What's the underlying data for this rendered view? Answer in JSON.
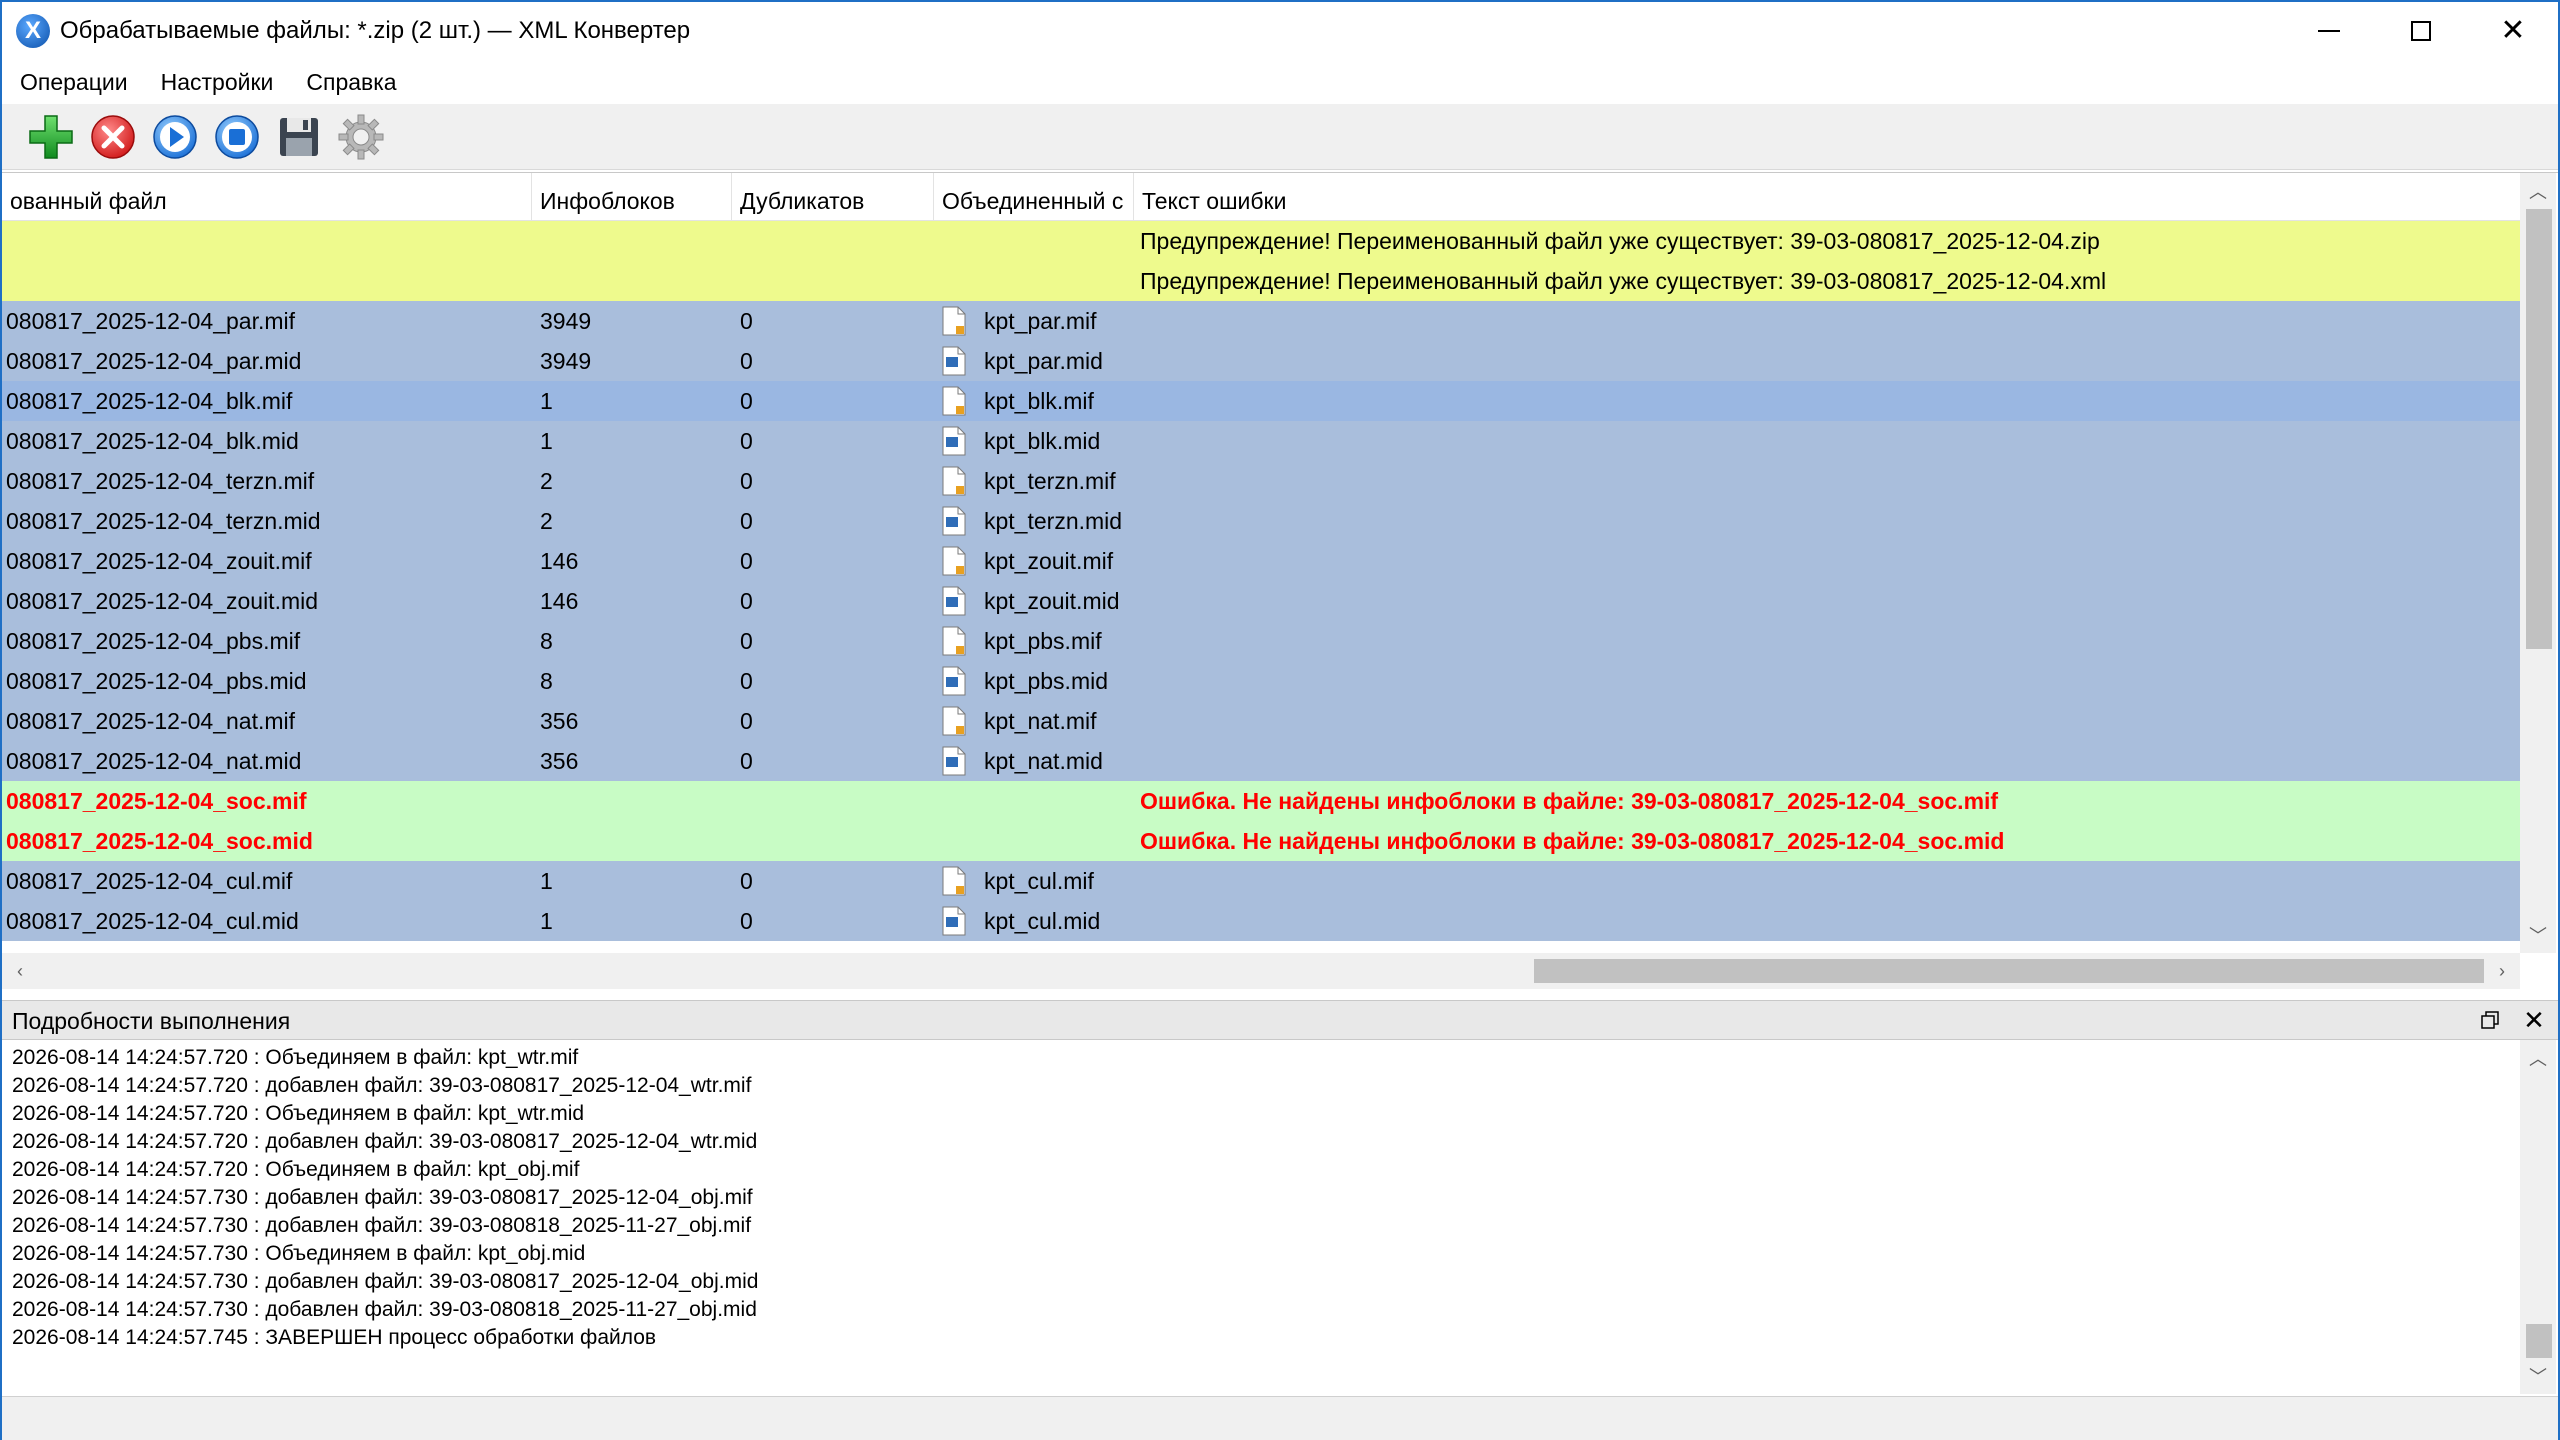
{
  "window": {
    "title": "Обрабатываемые файлы: *.zip (2 шт.) — XML Конвертер",
    "app_icon": "X"
  },
  "menu": [
    "Операции",
    "Настройки",
    "Справка"
  ],
  "toolbar": {
    "icons": [
      "add-icon",
      "cancel-icon",
      "play-icon",
      "stop-icon",
      "save-icon",
      "settings-gear-icon"
    ]
  },
  "grid": {
    "columns": [
      "ованный файл",
      "Инфоблоков",
      "Дубликатов",
      "Объединенный с",
      "Текст ошибки"
    ],
    "rows": [
      {
        "kind": "warn",
        "file": "",
        "info": "",
        "dup": "",
        "merged": "",
        "icon": "",
        "error": "Предупреждение! Переименованный файл уже существует: 39-03-080817_2025-12-04.zip"
      },
      {
        "kind": "warn",
        "file": "",
        "info": "",
        "dup": "",
        "merged": "",
        "icon": "",
        "error": "Предупреждение! Переименованный файл уже существует: 39-03-080817_2025-12-04.xml"
      },
      {
        "kind": "norm",
        "file": "080817_2025-12-04_par.mif",
        "info": "3949",
        "dup": "0",
        "merged": "kpt_par.mif",
        "icon": "mif",
        "error": ""
      },
      {
        "kind": "norm",
        "file": "080817_2025-12-04_par.mid",
        "info": "3949",
        "dup": "0",
        "merged": "kpt_par.mid",
        "icon": "mid",
        "error": ""
      },
      {
        "kind": "sel",
        "file": "080817_2025-12-04_blk.mif",
        "info": "1",
        "dup": "0",
        "merged": "kpt_blk.mif",
        "icon": "mif",
        "error": ""
      },
      {
        "kind": "norm",
        "file": "080817_2025-12-04_blk.mid",
        "info": "1",
        "dup": "0",
        "merged": "kpt_blk.mid",
        "icon": "mid",
        "error": ""
      },
      {
        "kind": "norm",
        "file": "080817_2025-12-04_terzn.mif",
        "info": "2",
        "dup": "0",
        "merged": "kpt_terzn.mif",
        "icon": "mif",
        "error": ""
      },
      {
        "kind": "norm",
        "file": "080817_2025-12-04_terzn.mid",
        "info": "2",
        "dup": "0",
        "merged": "kpt_terzn.mid",
        "icon": "mid",
        "error": ""
      },
      {
        "kind": "norm",
        "file": "080817_2025-12-04_zouit.mif",
        "info": "146",
        "dup": "0",
        "merged": "kpt_zouit.mif",
        "icon": "mif",
        "error": ""
      },
      {
        "kind": "norm",
        "file": "080817_2025-12-04_zouit.mid",
        "info": "146",
        "dup": "0",
        "merged": "kpt_zouit.mid",
        "icon": "mid",
        "error": ""
      },
      {
        "kind": "norm",
        "file": "080817_2025-12-04_pbs.mif",
        "info": "8",
        "dup": "0",
        "merged": "kpt_pbs.mif",
        "icon": "mif",
        "error": ""
      },
      {
        "kind": "norm",
        "file": "080817_2025-12-04_pbs.mid",
        "info": "8",
        "dup": "0",
        "merged": "kpt_pbs.mid",
        "icon": "mid",
        "error": ""
      },
      {
        "kind": "norm",
        "file": "080817_2025-12-04_nat.mif",
        "info": "356",
        "dup": "0",
        "merged": "kpt_nat.mif",
        "icon": "mif",
        "error": ""
      },
      {
        "kind": "norm",
        "file": "080817_2025-12-04_nat.mid",
        "info": "356",
        "dup": "0",
        "merged": "kpt_nat.mid",
        "icon": "mid",
        "error": ""
      },
      {
        "kind": "err",
        "file": "080817_2025-12-04_soc.mif",
        "info": "",
        "dup": "",
        "merged": "",
        "icon": "",
        "error": "Ошибка. Не найдены инфоблоки в файле: 39-03-080817_2025-12-04_soc.mif"
      },
      {
        "kind": "err",
        "file": "080817_2025-12-04_soc.mid",
        "info": "",
        "dup": "",
        "merged": "",
        "icon": "",
        "error": "Ошибка. Не найдены инфоблоки в файле: 39-03-080817_2025-12-04_soc.mid"
      },
      {
        "kind": "norm",
        "file": "080817_2025-12-04_cul.mif",
        "info": "1",
        "dup": "0",
        "merged": "kpt_cul.mif",
        "icon": "mif",
        "error": ""
      },
      {
        "kind": "norm",
        "file": "080817_2025-12-04_cul.mid",
        "info": "1",
        "dup": "0",
        "merged": "kpt_cul.mid",
        "icon": "mid",
        "error": ""
      }
    ]
  },
  "details": {
    "title": "Подробности выполнения",
    "log": [
      "2026-08-14 14:24:57.720 : Объединяем в файл: kpt_wtr.mif",
      "2026-08-14 14:24:57.720 : добавлен файл: 39-03-080817_2025-12-04_wtr.mif",
      "2026-08-14 14:24:57.720 : Объединяем в файл: kpt_wtr.mid",
      "2026-08-14 14:24:57.720 : добавлен файл: 39-03-080817_2025-12-04_wtr.mid",
      "2026-08-14 14:24:57.720 : Объединяем в файл: kpt_obj.mif",
      "2026-08-14 14:24:57.730 : добавлен файл: 39-03-080817_2025-12-04_obj.mif",
      "2026-08-14 14:24:57.730 : добавлен файл: 39-03-080818_2025-11-27_obj.mif",
      "2026-08-14 14:24:57.730 : Объединяем в файл: kpt_obj.mid",
      "2026-08-14 14:24:57.730 : добавлен файл: 39-03-080817_2025-12-04_obj.mid",
      "2026-08-14 14:24:57.730 : добавлен файл: 39-03-080818_2025-11-27_obj.mid",
      "2026-08-14 14:24:57.745 : ЗАВЕРШЕН процесс обработки файлов"
    ]
  },
  "colors": {
    "row_normal": "#a9bedc",
    "row_selected": "#9ab7e2",
    "row_warning": "#eefa8d",
    "row_error": "#c8fcc5",
    "error_text": "#ff0000"
  }
}
